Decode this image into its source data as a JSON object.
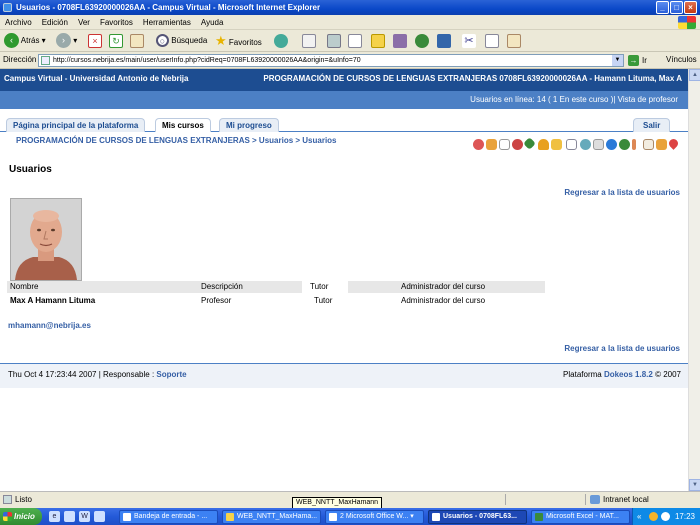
{
  "window": {
    "title": "Usuarios - 0708FL63920000026AA - Campus Virtual - Microsoft Internet Explorer"
  },
  "menu": [
    "Archivo",
    "Edición",
    "Ver",
    "Favoritos",
    "Herramientas",
    "Ayuda"
  ],
  "toolbar": {
    "back": "Atrás",
    "search": "Búsqueda",
    "favorites": "Favoritos"
  },
  "address": {
    "label": "Dirección",
    "url": "http://cursos.nebrija.es/main/user/userInfo.php?cidReq=0708FL63920000026AA&origin=&uInfo=70",
    "go": "Ir",
    "links": "Vínculos"
  },
  "site": {
    "name": "Campus Virtual - Universidad Antonio de Nebrija",
    "course_title": "PROGRAMACIÓN DE CURSOS DE LENGUAS EXTRANJERAS 0708FL63920000026AA - Hamann Lituma, Max A",
    "online": "Usuarios en línea:  14  ( 1 En este curso )| Vista de profesor"
  },
  "tabs": [
    "Página principal de la plataforma",
    "Mis cursos",
    "Mi progreso"
  ],
  "logout": "Salir",
  "breadcrumb": "PROGRAMACIÓN DE CURSOS DE LENGUAS EXTRANJERAS > Usuarios > Usuarios",
  "page_title": "Usuarios",
  "back_link": "Regresar a la lista de usuarios",
  "table": {
    "headers": [
      "Nombre",
      "Descripción",
      "Tutor",
      "Administrador del curso"
    ],
    "row": [
      "Max A Hamann Lituma",
      "Profesor",
      "Tutor",
      "Administrador del curso"
    ]
  },
  "email": "mhamann@nebrija.es",
  "footer": {
    "left_prefix": "Thu Oct 4 17:23:44 2007 | Responsable : ",
    "responsable": "Soporte",
    "right_prefix": "Plataforma ",
    "platform": "Dokeos 1.8.2",
    "right_suffix": " © 2007"
  },
  "status": {
    "text": "Listo",
    "zone": "Intranet local"
  },
  "tooltip": "WEB_NNTT_MaxHamann",
  "taskbar": {
    "start": "Inicio",
    "tasks": [
      "Bandeja de entrada - ...",
      "WEB_NNTT_MaxHama...",
      "2 Microsoft Office W...",
      "Usuarios - 0708FL63...",
      "Microsoft Excel - MAT..."
    ],
    "clock": "17:23"
  },
  "colors": {
    "header_dark": "#1d4d91",
    "header_light": "#4c80c5",
    "link": "#355fa5"
  }
}
